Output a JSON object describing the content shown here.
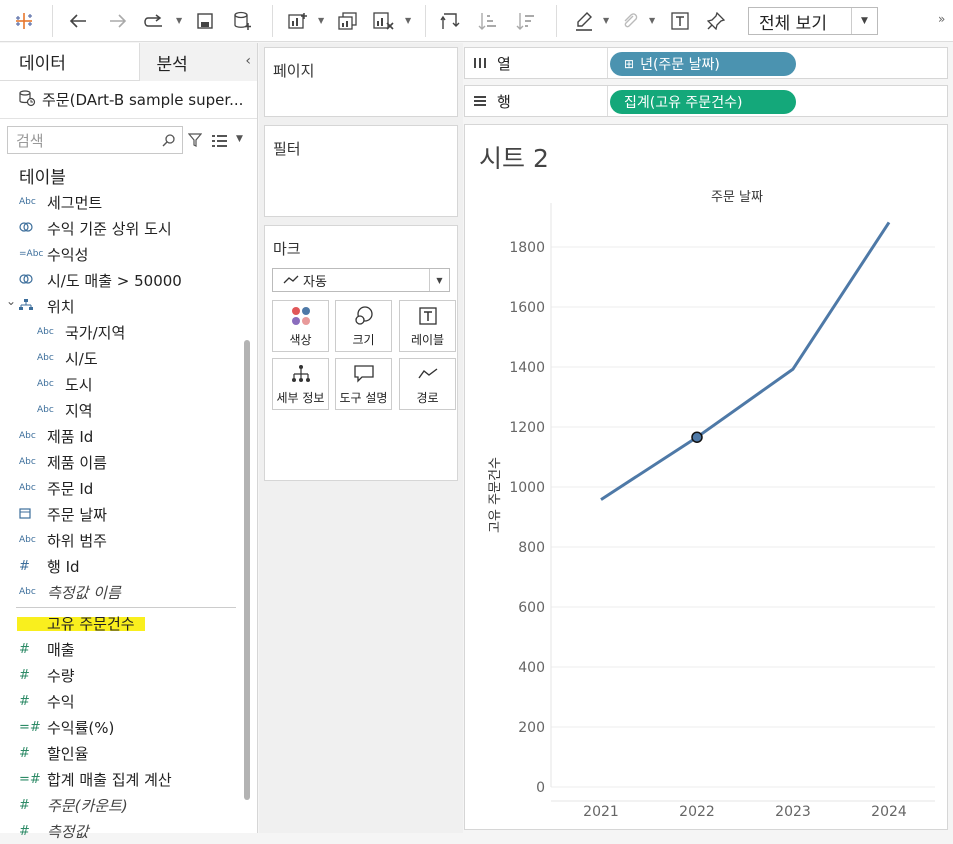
{
  "toolbar": {
    "view_label": "전체 보기",
    "icons": [
      "tableau-logo-icon",
      "back-icon",
      "forward-icon",
      "redo-icon",
      "save-icon",
      "new-datasource-icon",
      "new-worksheet-icon",
      "duplicate-icon",
      "clear-sheet-icon",
      "swap-icon",
      "sort-ascending-icon",
      "sort-descending-icon",
      "highlight-icon",
      "annotate-icon",
      "text-icon",
      "pin-icon"
    ],
    "more": "»"
  },
  "left_panel": {
    "tabs": [
      "데이터",
      "분석"
    ],
    "collapse": "‹",
    "datasource": "주문(DArt-B sample super...",
    "search_placeholder": "검색",
    "tables_heading": "테이블",
    "fields": [
      {
        "type": "Abc",
        "name": "세그먼트",
        "kind": "dim",
        "indent": 0
      },
      {
        "type": "set",
        "name": "수익 기준 상위 도시",
        "kind": "set",
        "indent": 0
      },
      {
        "type": "=Abc",
        "name": "수익성",
        "kind": "dim",
        "indent": 0
      },
      {
        "type": "set",
        "name": "시/도 매출 > 50000",
        "kind": "set",
        "indent": 0
      },
      {
        "type": "hier",
        "name": "위치",
        "kind": "hier",
        "indent": 0
      },
      {
        "type": "Abc",
        "name": "국가/지역",
        "kind": "dim",
        "indent": 1
      },
      {
        "type": "Abc",
        "name": "시/도",
        "kind": "dim",
        "indent": 1
      },
      {
        "type": "Abc",
        "name": "도시",
        "kind": "dim",
        "indent": 1
      },
      {
        "type": "Abc",
        "name": "지역",
        "kind": "dim",
        "indent": 1
      },
      {
        "type": "Abc",
        "name": "제품 Id",
        "kind": "dim",
        "indent": 0
      },
      {
        "type": "Abc",
        "name": "제품 이름",
        "kind": "dim",
        "indent": 0
      },
      {
        "type": "Abc",
        "name": "주문 Id",
        "kind": "dim",
        "indent": 0
      },
      {
        "type": "date",
        "name": "주문 날짜",
        "kind": "dim",
        "indent": 0
      },
      {
        "type": "Abc",
        "name": "하위 범주",
        "kind": "dim",
        "indent": 0
      },
      {
        "type": "#",
        "name": "행 Id",
        "kind": "dim",
        "indent": 0
      },
      {
        "type": "Abc",
        "name": "측정값 이름",
        "kind": "dim",
        "indent": 0,
        "italic": true
      },
      {
        "type": "=#",
        "name": "고유 주문건수",
        "kind": "meas",
        "indent": 0,
        "highlight": true
      },
      {
        "type": "#",
        "name": "매출",
        "kind": "meas",
        "indent": 0
      },
      {
        "type": "#",
        "name": "수량",
        "kind": "meas",
        "indent": 0
      },
      {
        "type": "#",
        "name": "수익",
        "kind": "meas",
        "indent": 0
      },
      {
        "type": "=#",
        "name": "수익률(%)",
        "kind": "meas",
        "indent": 0
      },
      {
        "type": "#",
        "name": "할인율",
        "kind": "meas",
        "indent": 0
      },
      {
        "type": "=#",
        "name": "합계 매출 집계 계산",
        "kind": "meas",
        "indent": 0
      },
      {
        "type": "#",
        "name": "주문(카운트)",
        "kind": "meas",
        "indent": 0,
        "italic": true
      },
      {
        "type": "#",
        "name": "측정값",
        "kind": "meas",
        "indent": 0,
        "italic": true
      }
    ]
  },
  "cards": {
    "pages": "페이지",
    "filters": "필터",
    "marks": "마크",
    "mark_type": "자동",
    "mark_buttons": [
      "색상",
      "크기",
      "레이블",
      "세부 정보",
      "도구 설명",
      "경로"
    ]
  },
  "shelves": {
    "columns_label": "열",
    "columns_pill": "년(주문 날짜)",
    "rows_label": "행",
    "rows_pill": "집계(고유 주문건수)"
  },
  "sheet": {
    "title": "시트 2"
  },
  "chart_data": {
    "type": "line",
    "title": "주문 날짜",
    "xlabel": "",
    "ylabel": "고유 주문건수",
    "categories": [
      "2021",
      "2022",
      "2023",
      "2024"
    ],
    "values": [
      958,
      1166,
      1393,
      1882
    ],
    "ylim": [
      0,
      1950
    ],
    "yticks": [
      0,
      200,
      400,
      600,
      800,
      1000,
      1200,
      1400,
      1600,
      1800
    ],
    "highlighted_point": "2022",
    "line_color": "#4e79a7",
    "grid": true
  },
  "colors": {
    "pill_blue": "#4b93b0",
    "pill_green": "#14a87a",
    "highlight": "#f9ef1e"
  }
}
